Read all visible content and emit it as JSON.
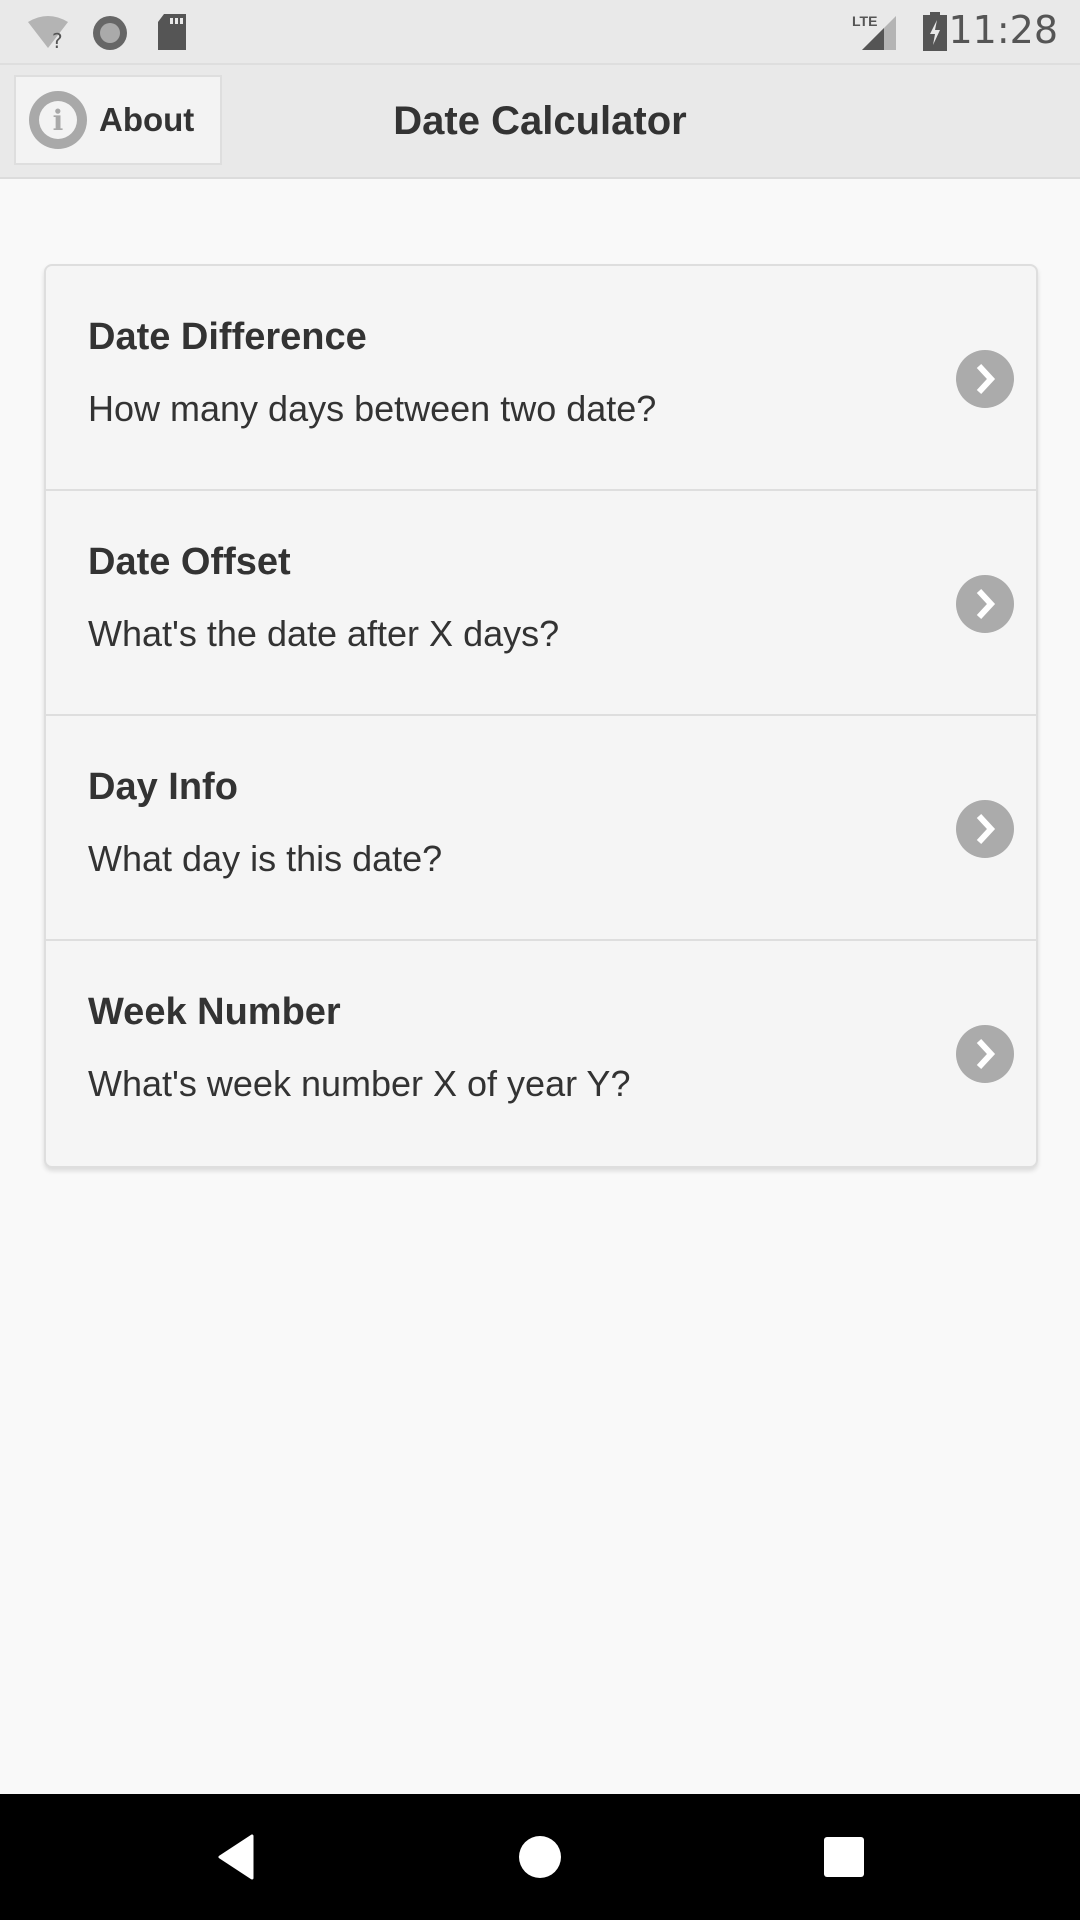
{
  "status_bar": {
    "time": "11:28",
    "icons": [
      "wifi-unknown-icon",
      "sync-circle-icon",
      "sd-card-icon",
      "lte-signal-icon",
      "battery-charging-icon"
    ],
    "network_label": "LTE"
  },
  "header": {
    "about_label": "About",
    "title": "Date Calculator"
  },
  "menu": {
    "items": [
      {
        "title": "Date Difference",
        "subtitle": "How many days between two date?"
      },
      {
        "title": "Date Offset",
        "subtitle": "What's the date after X days?"
      },
      {
        "title": "Day Info",
        "subtitle": "What day is this date?"
      },
      {
        "title": "Week Number",
        "subtitle": "What's week number X of year Y?"
      }
    ]
  },
  "nav_bar": {
    "buttons": [
      "back",
      "home",
      "recents"
    ]
  }
}
